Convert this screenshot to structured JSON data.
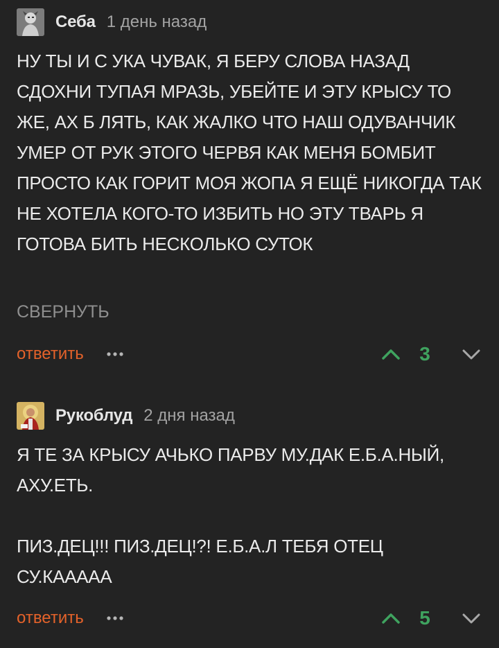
{
  "comments": [
    {
      "author": "Себа",
      "time": "1 день назад",
      "text": "НУ ТЫ И С УКА ЧУВАК, Я БЕРУ СЛОВА НАЗАД СДОХНИ ТУПАЯ МРАЗЬ, УБЕЙТЕ И ЭТУ КРЫСУ ТО ЖЕ, АХ Б ЛЯТЬ, КАК ЖАЛКО ЧТО НАШ ОДУВАНЧИК УМЕР ОТ РУК ЭТОГО ЧЕРВЯ КАК МЕНЯ БОМБИТ ПРОСТО КАК ГОРИТ МОЯ ЖОПА Я ЕЩЁ НИКОГДА ТАК НЕ ХОТЕЛА КОГО-ТО ИЗБИТЬ НО ЭТУ ТВАРЬ Я ГОТОВА БИТЬ НЕСКОЛЬКО СУТОК",
      "collapse_label": "СВЕРНУТЬ",
      "reply_label": "ответить",
      "score": "3",
      "avatar_icon": "avatar-character-icon"
    },
    {
      "author": "Рукоблуд",
      "time": "2 дня назад",
      "text": "Я ТЕ ЗА КРЫСУ АЧЬКО ПАРВУ МУ.ДАК Е.Б.А.НЫЙ, АХУ.ЕТЬ.\n\nПИЗ.ДЕЦ!!! ПИЗ.ДЕЦ!?! Е.Б.А.Л ТЕБЯ ОТЕЦ СУ.КААААА",
      "reply_label": "ответить",
      "score": "5",
      "avatar_icon": "avatar-icon-painting"
    }
  ],
  "colors": {
    "background": "#232323",
    "reply": "#e4622a",
    "score": "#3fa35f",
    "vote_up": "#3fa35f",
    "vote_down": "#a8a8a8"
  }
}
